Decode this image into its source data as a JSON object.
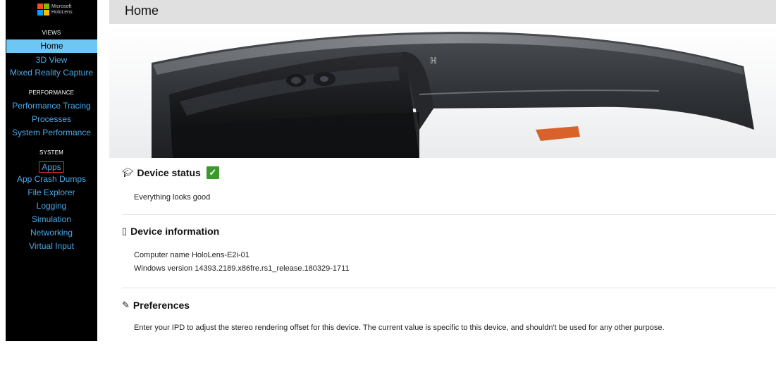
{
  "brand": {
    "logo_line1": "Microsoft",
    "logo_line2": "HoloLens",
    "colors": [
      "#f25022",
      "#7fba00",
      "#00a4ef",
      "#ffb900"
    ]
  },
  "sidebar": {
    "views_label": "VIEWS",
    "views": [
      {
        "label": "Home",
        "selected": true
      },
      {
        "label": "3D View"
      },
      {
        "label": "Mixed Reality Capture"
      }
    ],
    "performance_label": "PERFORMANCE",
    "performance": [
      {
        "label": "Performance Tracing"
      },
      {
        "label": "Processes"
      },
      {
        "label": "System Performance"
      }
    ],
    "system_label": "SYSTEM",
    "system": [
      {
        "label": "Apps",
        "highlighted": true
      },
      {
        "label": "App Crash Dumps"
      },
      {
        "label": "File Explorer"
      },
      {
        "label": "Logging"
      },
      {
        "label": "Simulation"
      },
      {
        "label": "Networking"
      },
      {
        "label": "Virtual Input"
      }
    ]
  },
  "header": {
    "title": "Home"
  },
  "device_status": {
    "title": "Device status",
    "icon": "graduation-cap-icon",
    "status_icon": "checkmark-icon",
    "message": "Everything looks good"
  },
  "device_information": {
    "title": "Device information",
    "icon": "device-icon",
    "computer_name_label": "Computer name",
    "computer_name": "HoloLens-E2i-01",
    "windows_version_label": "Windows version",
    "windows_version": "14393.2189.x86fre.rs1_release.180329-1711"
  },
  "preferences": {
    "title": "Preferences",
    "icon": "pencil-icon",
    "description": "Enter your IPD to adjust the stereo rendering offset for this device. The current value is specific to this device, and shouldn't be used for any other purpose."
  }
}
